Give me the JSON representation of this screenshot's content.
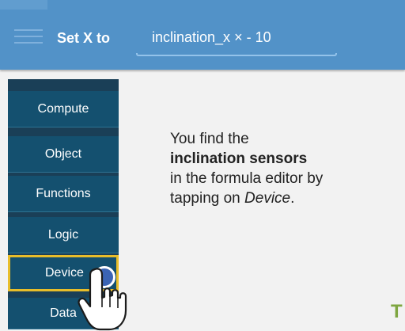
{
  "header": {
    "brick_label": "Set X to",
    "formula": "inclination_x × - 10"
  },
  "categories": {
    "items": [
      {
        "label": "Compute"
      },
      {
        "label": "Object"
      },
      {
        "label": "Functions"
      },
      {
        "label": "Logic"
      },
      {
        "label": "Device"
      },
      {
        "label": "Data"
      }
    ],
    "selected": "Device"
  },
  "tutorial": {
    "line1": "You find the",
    "line2": "inclination sensors",
    "line3": "in the formula editor by",
    "line4_prefix": "tapping on ",
    "line4_em": "Device",
    "line4_suffix": "."
  },
  "next_hint": "T",
  "colors": {
    "header_blue": "#5292c8",
    "category_bg": "#14506f",
    "highlight": "#e8bd2a",
    "next_hint_green": "#7ea640"
  },
  "icons": {
    "menu": "hamburger-icon",
    "tap": "tap-indicator-icon",
    "hand": "pointing-hand-icon"
  }
}
